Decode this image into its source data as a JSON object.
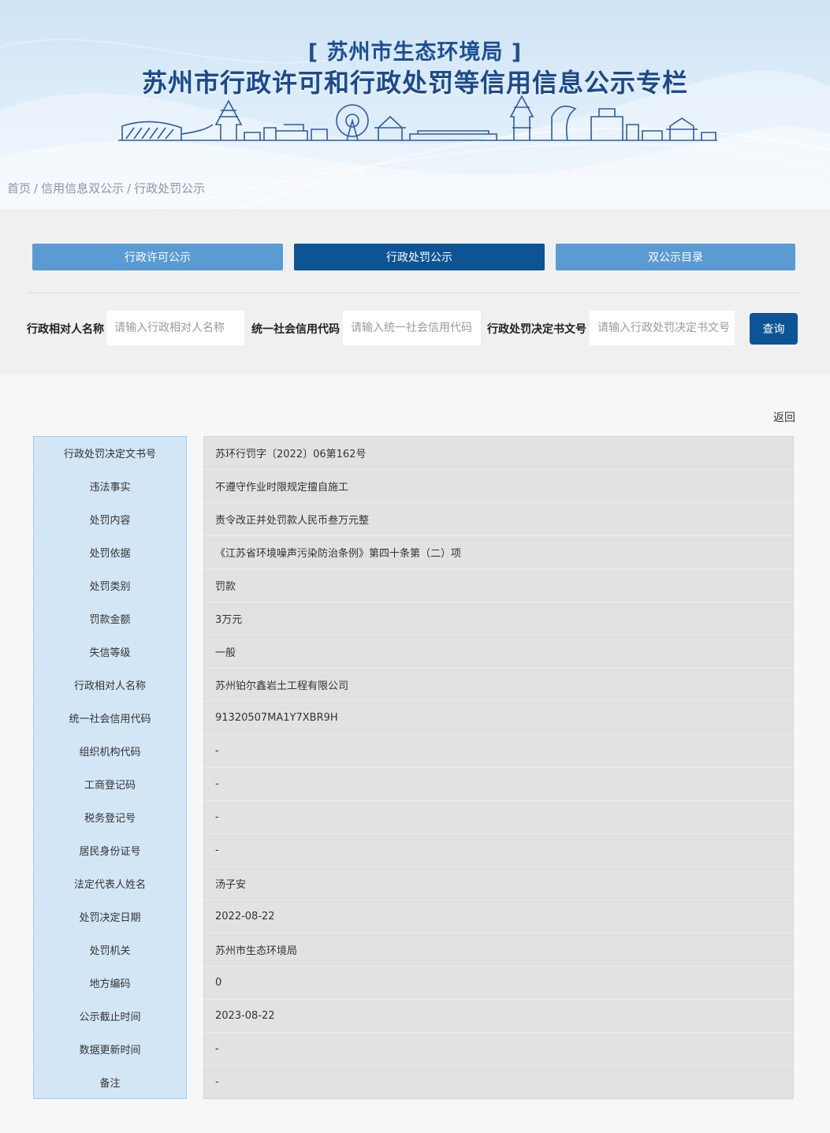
{
  "banner": {
    "org": "[ 苏州市生态环境局 ]",
    "title": "苏州市行政许可和行政处罚等信用信息公示专栏"
  },
  "breadcrumb": {
    "items": [
      "首页",
      "信用信息双公示",
      "行政处罚公示"
    ],
    "separator": "/"
  },
  "nav": {
    "tabs": [
      {
        "label": "行政许可公示",
        "active": false
      },
      {
        "label": "行政处罚公示",
        "active": true
      },
      {
        "label": "双公示目录",
        "active": false
      }
    ]
  },
  "search": {
    "fields": [
      {
        "label": "行政相对人名称",
        "placeholder": "请输入行政相对人名称",
        "value": ""
      },
      {
        "label": "统一社会信用代码",
        "placeholder": "请输入统一社会信用代码",
        "value": ""
      },
      {
        "label": "行政处罚决定书文号",
        "placeholder": "请输入行政处罚决定书文号",
        "value": ""
      }
    ],
    "button_label": "查询"
  },
  "back_label": "返回",
  "colors": {
    "primary": "#0c5494",
    "nav_inactive": "#5b9bd3",
    "label_bg": "#d2e6f6",
    "value_bg": "#e2e2e2"
  },
  "details": [
    {
      "label": "行政处罚决定文书号",
      "value": "苏环行罚字〔2022〕06第162号"
    },
    {
      "label": "违法事实",
      "value": "不遵守作业时限规定擅自施工"
    },
    {
      "label": "处罚内容",
      "value": "责令改正并处罚款人民币叁万元整"
    },
    {
      "label": "处罚依据",
      "value": "《江苏省环境噪声污染防治条例》第四十条第（二）项"
    },
    {
      "label": "处罚类别",
      "value": "罚款"
    },
    {
      "label": "罚款金额",
      "value": "3万元"
    },
    {
      "label": "失信等级",
      "value": "一般"
    },
    {
      "label": "行政相对人名称",
      "value": "苏州铂尔鑫岩土工程有限公司"
    },
    {
      "label": "统一社会信用代码",
      "value": "91320507MA1Y7XBR9H"
    },
    {
      "label": "组织机构代码",
      "value": "-"
    },
    {
      "label": "工商登记码",
      "value": "-"
    },
    {
      "label": "税务登记号",
      "value": "-"
    },
    {
      "label": "居民身份证号",
      "value": "-"
    },
    {
      "label": "法定代表人姓名",
      "value": "汤子安"
    },
    {
      "label": "处罚决定日期",
      "value": "2022-08-22"
    },
    {
      "label": "处罚机关",
      "value": "苏州市生态环境局"
    },
    {
      "label": "地方编码",
      "value": "0"
    },
    {
      "label": "公示截止时间",
      "value": "2023-08-22"
    },
    {
      "label": "数据更新时间",
      "value": "-"
    },
    {
      "label": "备注",
      "value": "-"
    }
  ]
}
